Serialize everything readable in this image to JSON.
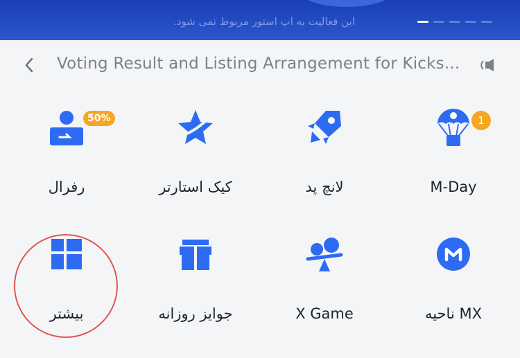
{
  "banner": {
    "text": "این فعالیت به اپ استور مربوط نمی شود."
  },
  "notice": {
    "title": "Voting Result and Listing Arrangement for Kicks..."
  },
  "tiles": [
    {
      "label": "M-Day",
      "icon": "parachute-icon",
      "badge": "1"
    },
    {
      "label": "لانچ پد",
      "icon": "rocket-icon"
    },
    {
      "label": "کیک استارتر",
      "icon": "star-icon"
    },
    {
      "label": "رفرال",
      "icon": "person-icon",
      "badge": "50%"
    },
    {
      "label": "MX ناحیه",
      "icon": "mx-token-icon"
    },
    {
      "label": "X Game",
      "icon": "seesaw-icon"
    },
    {
      "label": "جوایز روزانه",
      "icon": "gift-icon"
    },
    {
      "label": "بیشتر",
      "icon": "grid-icon"
    }
  ],
  "colors": {
    "accent": "#2d6bf2",
    "badge": "#f5a623",
    "banner": "#2446c0",
    "highlight": "#e35454"
  }
}
